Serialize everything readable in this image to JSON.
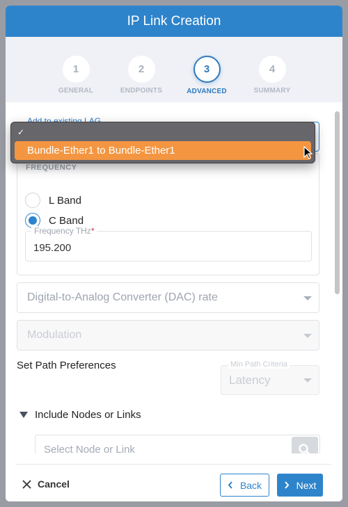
{
  "modal": {
    "title": "IP Link Creation"
  },
  "stepper": {
    "steps": [
      {
        "number": "1",
        "label": "GENERAL",
        "active": false
      },
      {
        "number": "2",
        "label": "ENDPOINTS",
        "active": false
      },
      {
        "number": "3",
        "label": "ADVANCED",
        "active": true
      },
      {
        "number": "4",
        "label": "SUMMARY",
        "active": false
      }
    ]
  },
  "form": {
    "lag": {
      "label": "Add to existing LAG",
      "dropdown_open": true,
      "options": [
        {
          "label": "",
          "checked": true
        },
        {
          "label": "Bundle-Ether1 to Bundle-Ether1",
          "highlighted": true
        }
      ]
    },
    "frequency": {
      "title": "FREQUENCY",
      "radios": [
        {
          "label": "L Band",
          "checked": false
        },
        {
          "label": "C Band",
          "checked": true
        }
      ],
      "input_label": "Frequency THz",
      "required_mark": "*",
      "input_value": "195.200"
    },
    "dac_rate": {
      "placeholder": "Digital-to-Analog Converter (DAC) rate"
    },
    "modulation": {
      "placeholder": "Modulation",
      "disabled": true
    },
    "path_preferences": {
      "title": "Set Path Preferences",
      "min_path_label": "Min Path Criteria",
      "min_path_value": "Latency"
    },
    "include": {
      "label": "Include Nodes or Links",
      "search_placeholder": "Select Node or Link"
    }
  },
  "footer": {
    "cancel_label": "Cancel",
    "back_label": "Back",
    "next_label": "Next"
  },
  "colors": {
    "primary": "#2e84cb",
    "highlight": "#f49641",
    "required": "#d0304a"
  }
}
